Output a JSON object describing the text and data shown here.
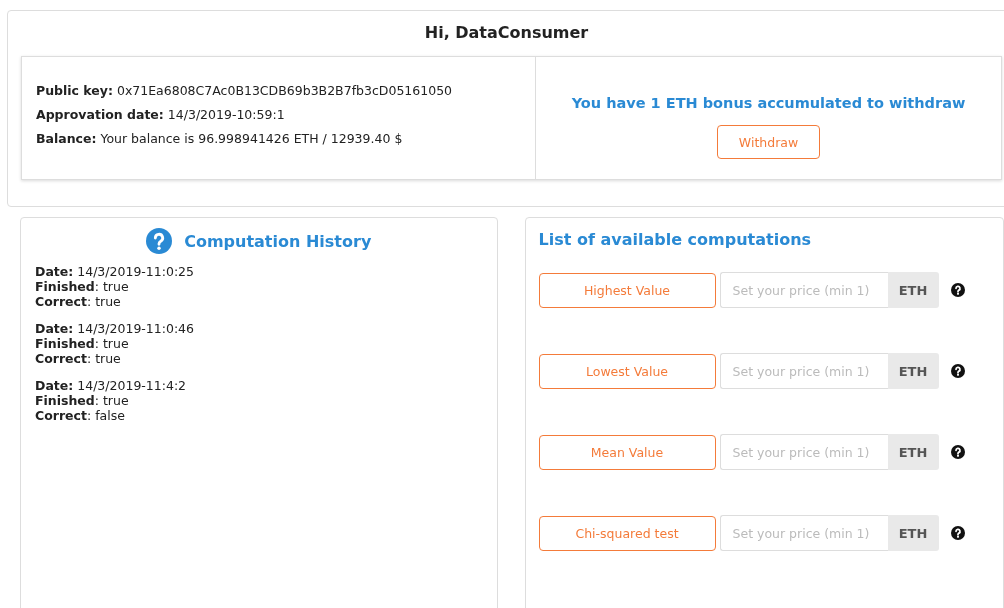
{
  "greeting": "Hi, DataConsumer",
  "account": {
    "lines": [
      "**Public key:** 0x71Ea6808C7Ac0B13CDB69b3B2B7fb3cD05161050",
      "**Approvation date:** 14/3/2019-10:59:1",
      "**Balance:** Your balance is 96.998941426 ETH / 12939.40 $"
    ],
    "bonus": "You have 1 ETH bonus accumulated to withdraw",
    "withdraw_button": "Withdraw"
  },
  "history": {
    "title": "Computation History",
    "entries": [
      {
        "lines": [
          "**Date:** 14/3/2019-11:0:25",
          "**Finished**: true",
          "**Correct**: true"
        ]
      },
      {
        "lines": [
          "**Date:** 14/3/2019-11:0:46",
          "**Finished**: true",
          "**Correct**: true"
        ]
      },
      {
        "lines": [
          "**Date:** 14/3/2019-11:4:2",
          "**Finished**: true",
          "**Correct**: false"
        ]
      }
    ]
  },
  "computations": {
    "title": "List of available computations",
    "items": [
      {
        "label": "Highest Value",
        "placeholder": "Set your price (min 1)",
        "unit": "ETH"
      },
      {
        "label": "Lowest Value",
        "placeholder": "Set your price (min 1)",
        "unit": "ETH"
      },
      {
        "label": "Mean Value",
        "placeholder": "Set your price (min 1)",
        "unit": "ETH"
      },
      {
        "label": "Chi-squared test",
        "placeholder": "Set your price (min 1)",
        "unit": "ETH"
      }
    ]
  }
}
